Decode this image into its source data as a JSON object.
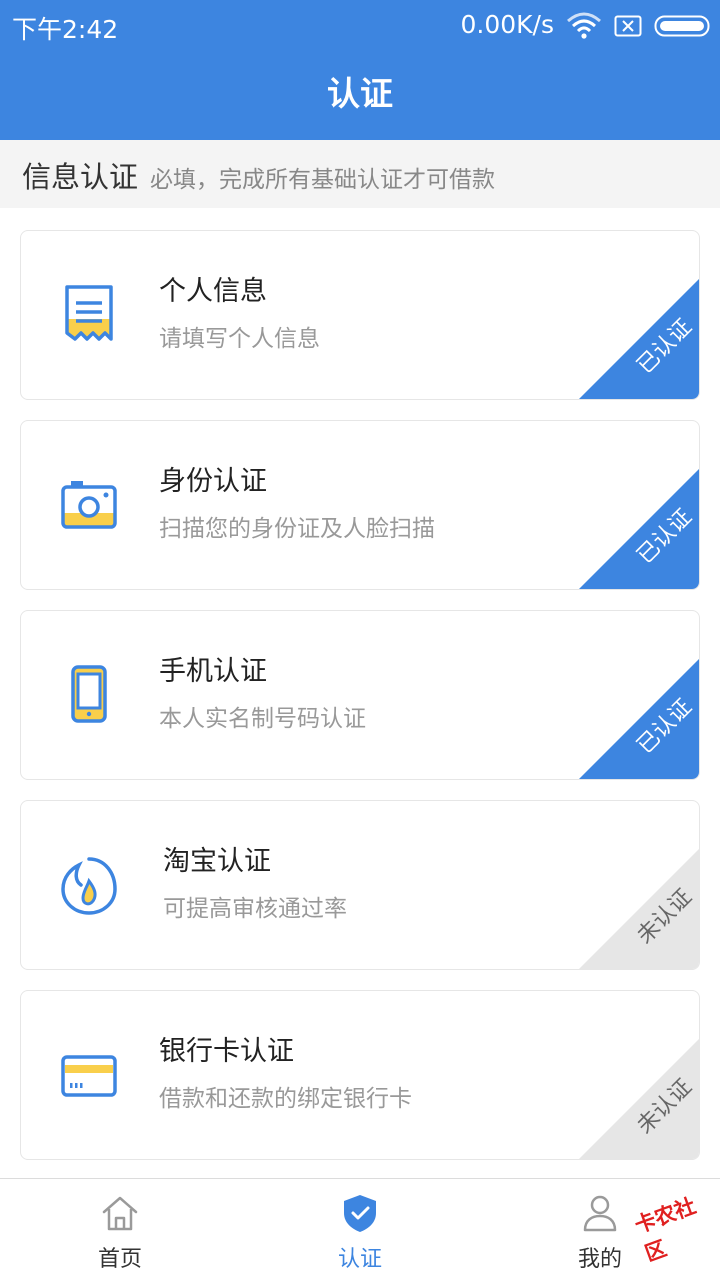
{
  "status_bar": {
    "time": "下午2:42",
    "net_speed": "0.00K/s",
    "icons": [
      "wifi-icon",
      "sim-disabled-icon",
      "battery-icon"
    ]
  },
  "nav": {
    "title": "认证"
  },
  "section": {
    "title": "信息认证",
    "subtitle": "必填，完成所有基础认证才可借款"
  },
  "cards": [
    {
      "title": "个人信息",
      "desc": "请填写个人信息",
      "status": "已认证",
      "icon": "document-icon"
    },
    {
      "title": "身份认证",
      "desc": "扫描您的身份证及人脸扫描",
      "status": "已认证",
      "icon": "camera-icon"
    },
    {
      "title": "手机认证",
      "desc": "本人实名制号码认证",
      "status": "已认证",
      "icon": "phone-icon"
    },
    {
      "title": "淘宝认证",
      "desc": "可提高审核通过率",
      "status": "未认证",
      "icon": "taobao-drop-icon"
    },
    {
      "title": "银行卡认证",
      "desc": "借款和还款的绑定银行卡",
      "status": "未认证",
      "icon": "bank-card-icon"
    }
  ],
  "tabs": [
    {
      "label": "首页",
      "icon": "home-icon",
      "active": false
    },
    {
      "label": "认证",
      "icon": "shield-check-icon",
      "active": true
    },
    {
      "label": "我的",
      "icon": "user-icon",
      "active": false
    }
  ],
  "watermark": "卡农社区",
  "colors": {
    "primary": "#3d85e0",
    "accent": "#f9cf4b",
    "unverified": "#e6e6e6"
  }
}
